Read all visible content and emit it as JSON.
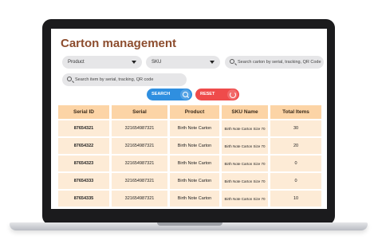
{
  "page": {
    "title": "Carton management"
  },
  "filters": {
    "product_select": "Product",
    "sku_select": "SKU",
    "carton_search_placeholder": "Search carton by serial, tracking, QR Code",
    "item_search_placeholder": "Search item by serial, tracking, QR code"
  },
  "actions": {
    "search_label": "SEARCH",
    "reset_label": "RESET"
  },
  "table": {
    "columns": [
      "Serial ID",
      "Serial",
      "Product",
      "SKU Name",
      "Total Items"
    ],
    "rows": [
      {
        "serial_id": "87654321",
        "serial": "321654987321",
        "product": "Birth Note Carton",
        "sku_name": "Birth Note Carton Size 70",
        "total_items": "30"
      },
      {
        "serial_id": "87654322",
        "serial": "321654987321",
        "product": "Birth Note Carton",
        "sku_name": "Birth Note Carton Size 70",
        "total_items": "20"
      },
      {
        "serial_id": "87654323",
        "serial": "321654987321",
        "product": "Birth Note Carton",
        "sku_name": "Birth Note Carton Size 70",
        "total_items": "0"
      },
      {
        "serial_id": "87654333",
        "serial": "321654987321",
        "product": "Birth Note Carton",
        "sku_name": "Birth Note Carton Size 70",
        "total_items": "0"
      },
      {
        "serial_id": "87654335",
        "serial": "321654987321",
        "product": "Birth Note Carton",
        "sku_name": "Birth Note Carton Size 70",
        "total_items": "10"
      }
    ]
  }
}
